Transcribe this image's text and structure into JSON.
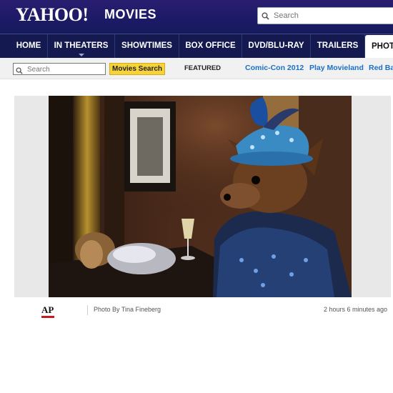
{
  "header": {
    "logo_text": "YAHOO!",
    "section_text": "MOVIES",
    "search_placeholder": "Search",
    "search_icon": "search-icon"
  },
  "nav": {
    "tabs": [
      {
        "label": "HOME",
        "active": false
      },
      {
        "label": "IN THEATERS",
        "active": false
      },
      {
        "label": "SHOWTIMES",
        "active": false
      },
      {
        "label": "BOX OFFICE",
        "active": false
      },
      {
        "label": "DVD/BLU-RAY",
        "active": false
      },
      {
        "label": "TRAILERS",
        "active": false
      },
      {
        "label": "PHOT",
        "active": true
      }
    ]
  },
  "subnav": {
    "search_placeholder": "Search",
    "movies_search_label": "Movies Search",
    "featured_label": "FEATURED",
    "links": [
      "Comic-Con 2012",
      "Play Movieland",
      "Red Ba"
    ]
  },
  "photo": {
    "description_icon": "photo-dogs-in-costume",
    "source_logo": "AP",
    "credit": "Photo By Tina Fineberg",
    "timestamp": "2 hours 6 minutes ago"
  },
  "colors": {
    "header_bg": "#1c1a66",
    "nav_bg": "#14194f",
    "search_button": "#f7d33a",
    "link_blue": "#1a70c8",
    "ap_red": "#c41a20"
  }
}
